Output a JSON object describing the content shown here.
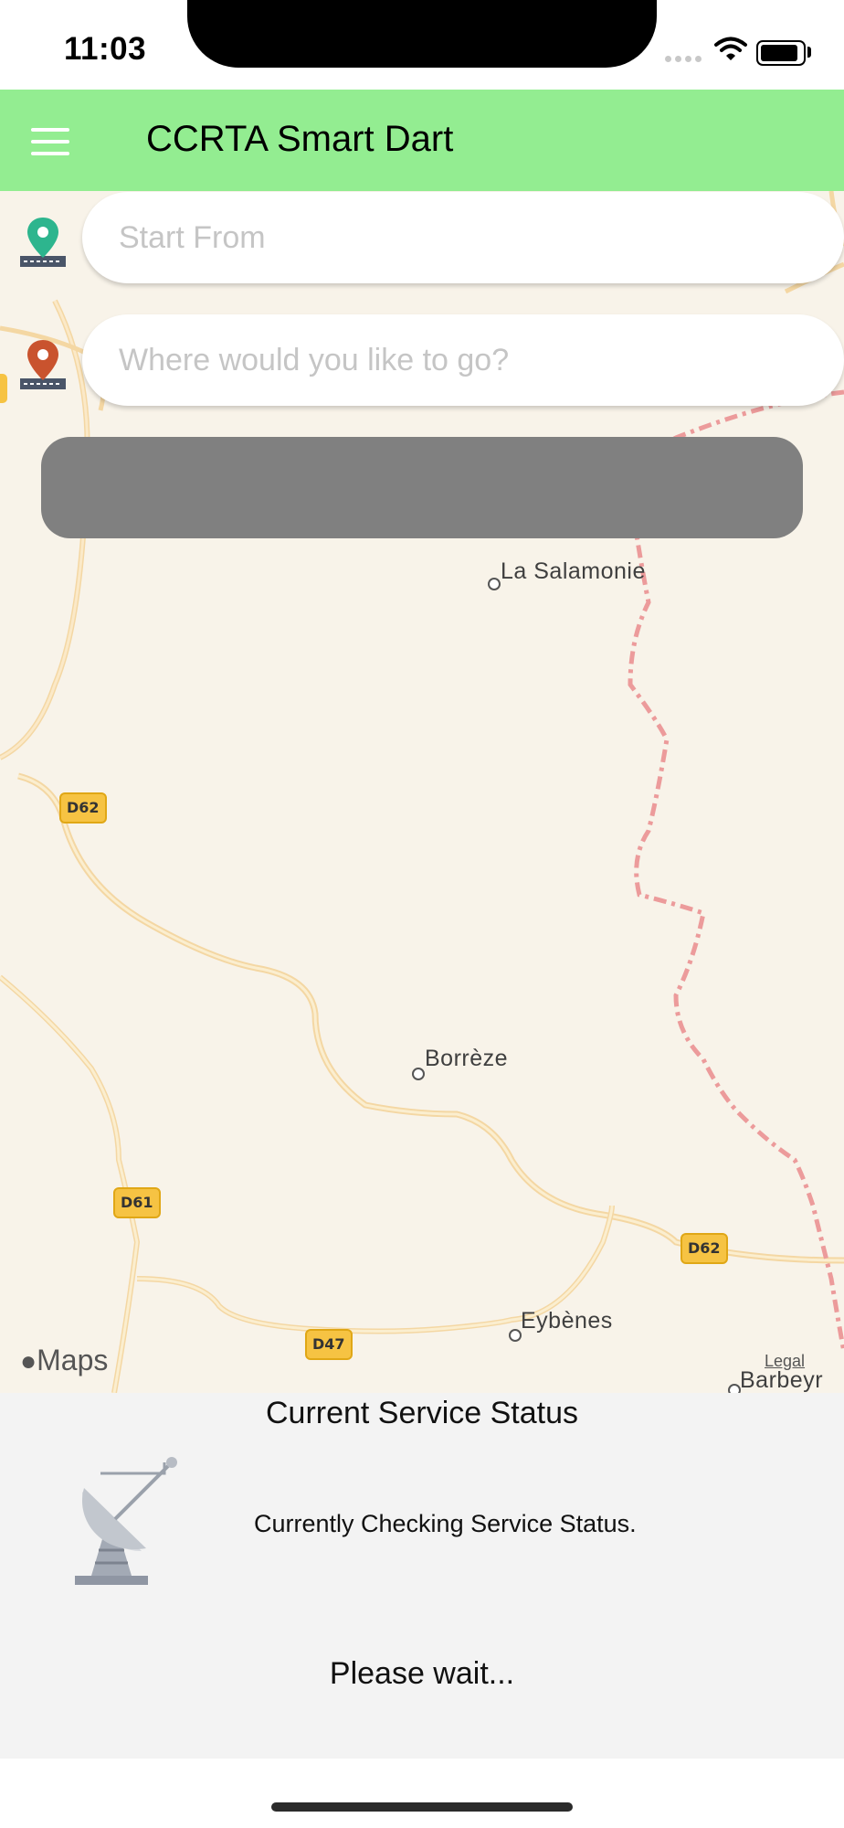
{
  "status_bar": {
    "time": "11:03"
  },
  "header": {
    "title": "CCRTA Smart Dart",
    "background": "#93ed91"
  },
  "route_form": {
    "start_placeholder": "Start From",
    "destination_placeholder": "Where would you like to go?",
    "start_pin_color": "#2db58e",
    "destination_pin_color": "#c9532e",
    "search_button_label": ""
  },
  "map": {
    "places": [
      "La Salamonie",
      "Borrèze",
      "Eybènes",
      "Barbeyr"
    ],
    "road_shields": [
      "D62",
      "D61",
      "D47",
      "D62"
    ],
    "attribution": "Maps",
    "legal_link": "Legal"
  },
  "service_status": {
    "title": "Current Service Status",
    "message": "Currently Checking Service Status.",
    "wait_text": "Please wait..."
  }
}
